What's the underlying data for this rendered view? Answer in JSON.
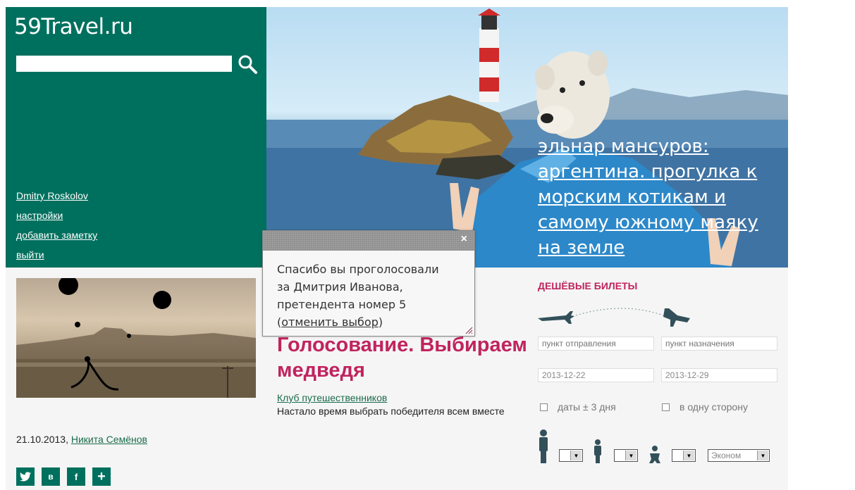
{
  "site": {
    "logo": "59Travel.ru"
  },
  "search": {
    "placeholder": ""
  },
  "user_menu": {
    "items": [
      "Dmitry Roskolov",
      "настройки",
      "добавить заметку",
      "выйти"
    ]
  },
  "hero": {
    "title": "эльнар мансуров: аргентина. прогулка к морским котикам и самому южному маяку на земле"
  },
  "popup": {
    "line1": "Спасибо вы проголосовали",
    "line2": "за Дмитрия Иванова,",
    "line3": "претендента номер 5",
    "cancel_prefix": "(",
    "cancel_link": "отменить выбор",
    "cancel_suffix": ")",
    "close": "×"
  },
  "post": {
    "title": "Голосование. Выбираем медведя",
    "club": "Клуб путешественников",
    "description": "Настало время выбрать победителя всем вместе",
    "date": "21.10.2013,",
    "author": "Никита Семёнов"
  },
  "share": {
    "buttons": [
      "twitter",
      "vk",
      "facebook",
      "plus"
    ],
    "vk_label": "в",
    "fb_label": "f",
    "plus_label": "+"
  },
  "tickets": {
    "title": "Дешёвые билеты",
    "from_placeholder": "пункт отправления",
    "to_placeholder": "пункт назначения",
    "date_from": "2013-12-22",
    "date_to": "2013-12-29",
    "flex_dates": "даты ± 3 дня",
    "one_way": "в одну сторону",
    "class_value": "Эконом"
  }
}
